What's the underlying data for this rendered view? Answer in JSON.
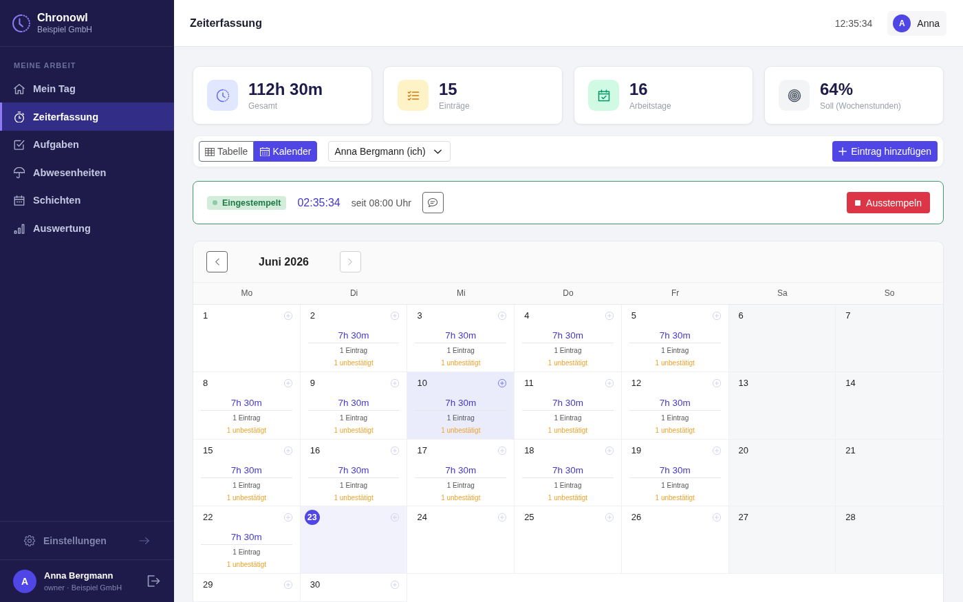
{
  "sidebar": {
    "brand": {
      "name": "Chronowl",
      "company": "Beispiel GmbH"
    },
    "section_label": "MEINE ARBEIT",
    "items": [
      {
        "label": "Mein Tag",
        "kind": "day",
        "selected": false
      },
      {
        "label": "Zeiterfassung",
        "kind": "time",
        "selected": true
      },
      {
        "label": "Aufgaben",
        "kind": "tasks",
        "selected": false
      },
      {
        "label": "Abwesenheiten",
        "kind": "absence",
        "selected": false
      },
      {
        "label": "Schichten",
        "kind": "shifts",
        "selected": false
      },
      {
        "label": "Auswertung",
        "kind": "reports",
        "selected": false
      }
    ],
    "settings": {
      "label": "Einstellungen"
    },
    "user": {
      "avatar": "A",
      "name": "Anna Bergmann",
      "role": "owner · Beispiel GmbH"
    }
  },
  "header": {
    "title": "Zeiterfassung",
    "time": "12:35:34",
    "user": {
      "avatar": "A",
      "name": "Anna"
    }
  },
  "stats": [
    {
      "kind": "total",
      "value": "112h 30m",
      "label": "Gesamt",
      "color": "#e0e7ff"
    },
    {
      "kind": "entries",
      "value": "15",
      "label": "Einträge",
      "color": "#fef3c7"
    },
    {
      "kind": "workdays",
      "value": "16",
      "label": "Arbeitstage",
      "color": "#d1fae5"
    },
    {
      "kind": "target",
      "value": "64%",
      "label": "Soll (Wochenstunden)",
      "color": "#f3f4f6"
    }
  ],
  "toolbar": {
    "views": [
      {
        "label": "Tabelle",
        "kind": "table",
        "selected": false
      },
      {
        "label": "Kalender",
        "kind": "calendar",
        "selected": true
      }
    ],
    "employee_select": {
      "value": "Anna Bergmann (ich)"
    },
    "add_button": "Eintrag hinzufügen"
  },
  "clock": {
    "status": "Eingestempelt",
    "clocked_in": true,
    "elapsed": "02:35:34",
    "since": "seit 08:00 Uhr",
    "stop_button": "Ausstempeln"
  },
  "calendar": {
    "month": "Juni 2026",
    "prev_disabled": false,
    "next_disabled": true,
    "weekdays": [
      "Mo",
      "Di",
      "Mi",
      "Do",
      "Fr",
      "Sa",
      "So"
    ],
    "weeks": [
      {
        "days": [
          {
            "day": "1",
            "kind": "weekday",
            "today": false,
            "hovered": false
          },
          {
            "day": "2",
            "kind": "weekday",
            "today": false,
            "hovered": false,
            "entry": {
              "hours": "7h 30m",
              "count": "1 Eintrag",
              "unconfirmed": "1 unbestätigt"
            }
          },
          {
            "day": "3",
            "kind": "weekday",
            "today": false,
            "hovered": false,
            "entry": {
              "hours": "7h 30m",
              "count": "1 Eintrag",
              "unconfirmed": "1 unbestätigt"
            }
          },
          {
            "day": "4",
            "kind": "weekday",
            "today": false,
            "hovered": false,
            "entry": {
              "hours": "7h 30m",
              "count": "1 Eintrag",
              "unconfirmed": "1 unbestätigt"
            }
          },
          {
            "day": "5",
            "kind": "weekday",
            "today": false,
            "hovered": false,
            "entry": {
              "hours": "7h 30m",
              "count": "1 Eintrag",
              "unconfirmed": "1 unbestätigt"
            }
          },
          {
            "day": "6",
            "kind": "weekend",
            "today": false,
            "hovered": false
          },
          {
            "day": "7",
            "kind": "weekend",
            "today": false,
            "hovered": false
          }
        ]
      },
      {
        "days": [
          {
            "day": "8",
            "kind": "weekday",
            "today": false,
            "hovered": false,
            "entry": {
              "hours": "7h 30m",
              "count": "1 Eintrag",
              "unconfirmed": "1 unbestätigt"
            }
          },
          {
            "day": "9",
            "kind": "weekday",
            "today": false,
            "hovered": false,
            "entry": {
              "hours": "7h 30m",
              "count": "1 Eintrag",
              "unconfirmed": "1 unbestätigt"
            }
          },
          {
            "day": "10",
            "kind": "weekday",
            "today": false,
            "hovered": true,
            "entry": {
              "hours": "7h 30m",
              "count": "1 Eintrag",
              "unconfirmed": "1 unbestätigt"
            }
          },
          {
            "day": "11",
            "kind": "weekday",
            "today": false,
            "hovered": false,
            "entry": {
              "hours": "7h 30m",
              "count": "1 Eintrag",
              "unconfirmed": "1 unbestätigt"
            }
          },
          {
            "day": "12",
            "kind": "weekday",
            "today": false,
            "hovered": false,
            "entry": {
              "hours": "7h 30m",
              "count": "1 Eintrag",
              "unconfirmed": "1 unbestätigt"
            }
          },
          {
            "day": "13",
            "kind": "weekend",
            "today": false,
            "hovered": false
          },
          {
            "day": "14",
            "kind": "weekend",
            "today": false,
            "hovered": false
          }
        ]
      },
      {
        "days": [
          {
            "day": "15",
            "kind": "weekday",
            "today": false,
            "hovered": false,
            "entry": {
              "hours": "7h 30m",
              "count": "1 Eintrag",
              "unconfirmed": "1 unbestätigt"
            }
          },
          {
            "day": "16",
            "kind": "weekday",
            "today": false,
            "hovered": false,
            "entry": {
              "hours": "7h 30m",
              "count": "1 Eintrag",
              "unconfirmed": "1 unbestätigt"
            }
          },
          {
            "day": "17",
            "kind": "weekday",
            "today": false,
            "hovered": false,
            "entry": {
              "hours": "7h 30m",
              "count": "1 Eintrag",
              "unconfirmed": "1 unbestätigt"
            }
          },
          {
            "day": "18",
            "kind": "weekday",
            "today": false,
            "hovered": false,
            "entry": {
              "hours": "7h 30m",
              "count": "1 Eintrag",
              "unconfirmed": "1 unbestätigt"
            }
          },
          {
            "day": "19",
            "kind": "weekday",
            "today": false,
            "hovered": false,
            "entry": {
              "hours": "7h 30m",
              "count": "1 Eintrag",
              "unconfirmed": "1 unbestätigt"
            }
          },
          {
            "day": "20",
            "kind": "weekend",
            "today": false,
            "hovered": false
          },
          {
            "day": "21",
            "kind": "weekend",
            "today": false,
            "hovered": false
          }
        ]
      },
      {
        "days": [
          {
            "day": "22",
            "kind": "weekday",
            "today": false,
            "hovered": false,
            "entry": {
              "hours": "7h 30m",
              "count": "1 Eintrag",
              "unconfirmed": "1 unbestätigt"
            }
          },
          {
            "day": "23",
            "kind": "weekday",
            "today": true,
            "hovered": false
          },
          {
            "day": "24",
            "kind": "weekday",
            "today": false,
            "hovered": false
          },
          {
            "day": "25",
            "kind": "weekday",
            "today": false,
            "hovered": false
          },
          {
            "day": "26",
            "kind": "weekday",
            "today": false,
            "hovered": false
          },
          {
            "day": "27",
            "kind": "weekend",
            "today": false,
            "hovered": false
          },
          {
            "day": "28",
            "kind": "weekend",
            "today": false,
            "hovered": false
          }
        ]
      },
      {
        "days": [
          {
            "day": "29",
            "kind": "weekday",
            "today": false,
            "hovered": false
          },
          {
            "day": "30",
            "kind": "weekday",
            "today": false,
            "hovered": false
          }
        ]
      }
    ]
  }
}
